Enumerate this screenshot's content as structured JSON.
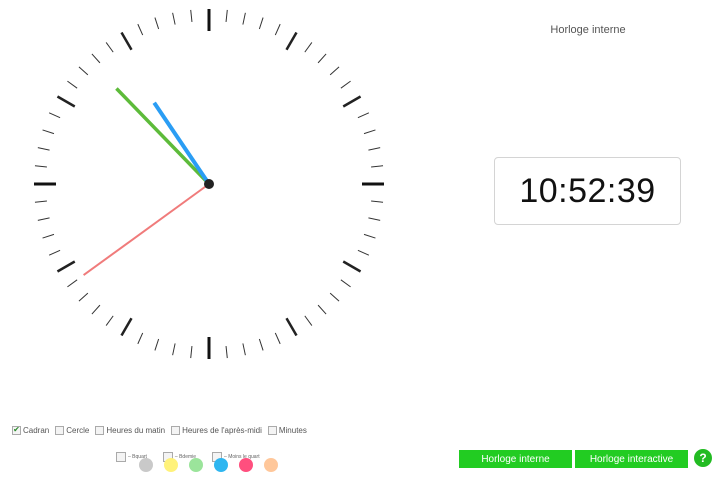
{
  "app_title": "Horloge interne",
  "digital_time": "10:52:39",
  "clock_time": {
    "hours": 10,
    "minutes": 52,
    "seconds": 39
  },
  "hand_colors": {
    "hour": "#2a9df4",
    "minute": "#5dbb3a",
    "second": "#f07b7b"
  },
  "options": [
    {
      "label": "Cadran",
      "checked": true
    },
    {
      "label": "Cercle",
      "checked": false
    },
    {
      "label": "Heures du matin",
      "checked": false
    },
    {
      "label": "Heures de l'après-midi",
      "checked": false
    },
    {
      "label": "Minutes",
      "checked": false
    }
  ],
  "sub_options": [
    {
      "label": "– Bquart",
      "checked": false
    },
    {
      "label": "– Bdemie",
      "checked": false
    },
    {
      "label": "– Moins le quart",
      "checked": false
    }
  ],
  "buttons": {
    "internal": "Horloge interne",
    "interactive": "Horloge interactive",
    "help": "?"
  },
  "color_swatches": [
    "#c9c9c9",
    "#fff27a",
    "#9be49b",
    "#2fb6f0",
    "#ff4f7e",
    "#ffc79a"
  ]
}
